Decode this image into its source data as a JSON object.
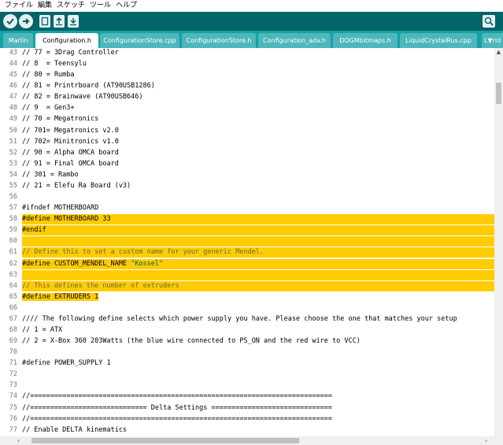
{
  "menu": [
    "ファイル",
    "編集",
    "スケッチ",
    "ツール",
    "ヘルプ"
  ],
  "toolbar": {
    "verify_icon": "check-icon",
    "upload_icon": "arrow-right-icon",
    "new_icon": "new-file-icon",
    "open_icon": "open-icon",
    "save_icon": "save-icon",
    "serial_icon": "serial-monitor-icon"
  },
  "tabs": [
    {
      "label": "Marlin",
      "active": false
    },
    {
      "label": "Configuration.h",
      "active": true
    },
    {
      "label": "ConfigurationStore.cpp",
      "active": false
    },
    {
      "label": "ConfigurationStore.h",
      "active": false
    },
    {
      "label": "Configuration_adv.h",
      "active": false
    },
    {
      "label": "DOGMbitmaps.h",
      "active": false
    },
    {
      "label": "LiquidCrystalRus.cpp",
      "active": false
    }
  ],
  "tab_menu_label": "L▼rid",
  "lines": [
    {
      "n": "43",
      "text": "// 77 = 3Drag Controller",
      "type": "plain"
    },
    {
      "n": "44",
      "text": "// 8  = Teensylu",
      "type": "plain"
    },
    {
      "n": "45",
      "text": "// 80 = Rumba",
      "type": "plain"
    },
    {
      "n": "46",
      "text": "// 81 = Printrboard (AT90USB1286)",
      "type": "plain"
    },
    {
      "n": "47",
      "text": "// 82 = Brainwave (AT90USB646)",
      "type": "plain"
    },
    {
      "n": "48",
      "text": "// 9  = Gen3+",
      "type": "plain"
    },
    {
      "n": "49",
      "text": "// 70 = Megatronics",
      "type": "plain"
    },
    {
      "n": "50",
      "text": "// 701= Megatronics v2.0",
      "type": "plain"
    },
    {
      "n": "51",
      "text": "// 702= Minitronics v1.0",
      "type": "plain"
    },
    {
      "n": "52",
      "text": "// 90 = Alpha OMCA board",
      "type": "plain"
    },
    {
      "n": "53",
      "text": "// 91 = Final OMCA board",
      "type": "plain"
    },
    {
      "n": "54",
      "text": "// 301 = Rambo",
      "type": "plain"
    },
    {
      "n": "55",
      "text": "// 21 = Elefu Ra Board (v3)",
      "type": "plain"
    },
    {
      "n": "56",
      "text": "",
      "type": "plain"
    },
    {
      "n": "57",
      "text": "#ifndef MOTHERBOARD",
      "type": "plain"
    },
    {
      "n": "58",
      "text": "#define MOTHERBOARD 33",
      "type": "hl"
    },
    {
      "n": "59",
      "text": "#endif",
      "type": "hl"
    },
    {
      "n": "60",
      "text": "",
      "type": "hl"
    },
    {
      "n": "61",
      "text": "// Define this to set a custom name for your generic Mendel.",
      "type": "hlcm"
    },
    {
      "n": "62",
      "text": "#define CUSTOM_MENDEL_NAME ",
      "str": "\"Kossel\"",
      "type": "hlstr"
    },
    {
      "n": "63",
      "text": "",
      "type": "hl"
    },
    {
      "n": "64",
      "text": "// This defines the number of extruders",
      "type": "hlcm"
    },
    {
      "n": "65",
      "text": "#define EXTRUDERS 1",
      "type": "hlpart"
    },
    {
      "n": "66",
      "text": "",
      "type": "plain"
    },
    {
      "n": "67",
      "text": "//// The following define selects which power supply you have. Please choose the one that matches your setup",
      "type": "plain"
    },
    {
      "n": "68",
      "text": "// 1 = ATX",
      "type": "plain"
    },
    {
      "n": "69",
      "text": "// 2 = X-Box 360 203Watts (the blue wire connected to PS_ON and the red wire to VCC)",
      "type": "plain"
    },
    {
      "n": "70",
      "text": "",
      "type": "plain"
    },
    {
      "n": "71",
      "text": "#define POWER_SUPPLY 1",
      "type": "plain"
    },
    {
      "n": "72",
      "text": "",
      "type": "plain"
    },
    {
      "n": "73",
      "text": "",
      "type": "plain"
    },
    {
      "n": "74",
      "text": "//===========================================================================",
      "type": "plain"
    },
    {
      "n": "75",
      "text": "//============================= Delta Settings ==============================",
      "type": "plain"
    },
    {
      "n": "76",
      "text": "//===========================================================================",
      "type": "plain"
    },
    {
      "n": "77",
      "text": "// Enable DELTA kinematics",
      "type": "plain"
    }
  ]
}
